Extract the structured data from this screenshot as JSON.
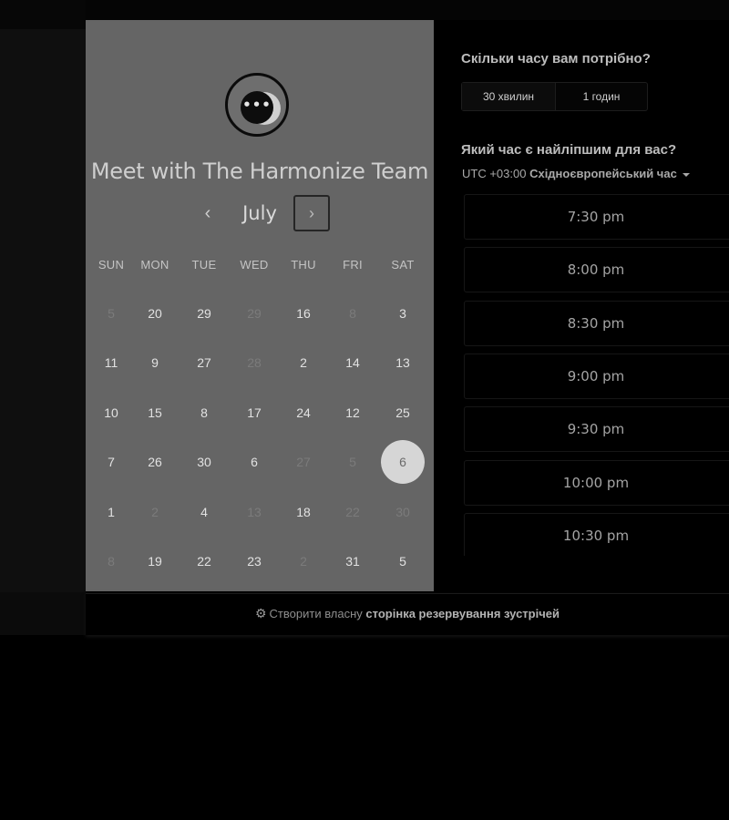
{
  "calendar": {
    "team_title": "Meet with The Harmonize Team",
    "month": "July",
    "prev_glyph": "‹",
    "next_glyph": "›",
    "logo_glyph": "•••",
    "weekdays": [
      "SUN",
      "MON",
      "TUE",
      "WED",
      "THU",
      "FRI",
      "SAT"
    ],
    "weeks": [
      [
        {
          "d": "5",
          "muted": true
        },
        {
          "d": "20"
        },
        {
          "d": "29"
        },
        {
          "d": "29",
          "muted": true
        },
        {
          "d": "16"
        },
        {
          "d": "8",
          "muted": true
        },
        {
          "d": "3"
        }
      ],
      [
        {
          "d": "11"
        },
        {
          "d": "9"
        },
        {
          "d": "27"
        },
        {
          "d": "28",
          "muted": true
        },
        {
          "d": "2"
        },
        {
          "d": "14"
        },
        {
          "d": "13"
        }
      ],
      [
        {
          "d": "10"
        },
        {
          "d": "15"
        },
        {
          "d": "8"
        },
        {
          "d": "17"
        },
        {
          "d": "24"
        },
        {
          "d": "12"
        },
        {
          "d": "25"
        }
      ],
      [
        {
          "d": "7"
        },
        {
          "d": "26"
        },
        {
          "d": "30"
        },
        {
          "d": "6"
        },
        {
          "d": "27",
          "muted": true
        },
        {
          "d": "5",
          "muted": true
        },
        {
          "d": "6",
          "selected": true
        }
      ],
      [
        {
          "d": "1"
        },
        {
          "d": "2",
          "muted": true
        },
        {
          "d": "4"
        },
        {
          "d": "13",
          "muted": true
        },
        {
          "d": "18"
        },
        {
          "d": "22",
          "muted": true
        },
        {
          "d": "30",
          "muted": true
        }
      ],
      [
        {
          "d": "8",
          "muted": true
        },
        {
          "d": "19"
        },
        {
          "d": "22"
        },
        {
          "d": "23"
        },
        {
          "d": "2",
          "muted": true
        },
        {
          "d": "31"
        },
        {
          "d": "5"
        }
      ]
    ]
  },
  "duration": {
    "question": "Скільки часу вам потрібно?",
    "options": [
      "30 хвилин",
      "1 годин"
    ]
  },
  "time": {
    "question": "Який час є найліпшим для вас?",
    "tz_prefix": "UTC +03:00 ",
    "tz_name": "Східноєвропейський час",
    "slots": [
      "7:30 pm",
      "8:00 pm",
      "8:30 pm",
      "9:00 pm",
      "9:30 pm",
      "10:00 pm",
      "10:30 pm"
    ]
  },
  "footer": {
    "icon_glyph": "⚙",
    "prefix": "Створити власну ",
    "bold": "сторінка резервування зустрічей"
  },
  "colors": {
    "panel": "#656565",
    "selected_day": "#d6d6d6",
    "background": "#000000"
  }
}
